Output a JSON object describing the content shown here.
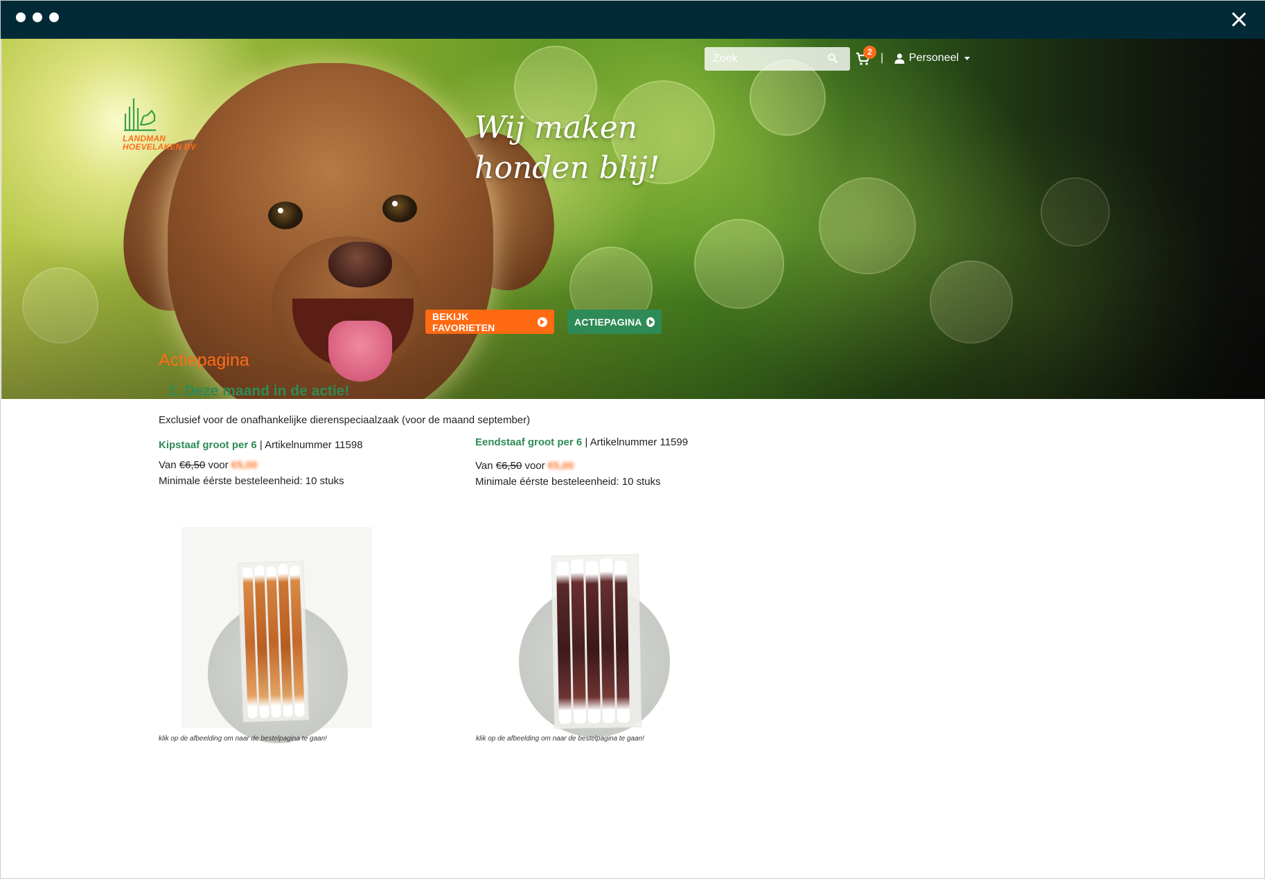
{
  "window": {
    "controls": [
      "dot",
      "dot",
      "dot"
    ],
    "close_icon": "close-icon"
  },
  "brand": {
    "logo_line1": "LANDMAN",
    "logo_line2": "HOEVELAKEN BV",
    "accent_orange": "#ff6c1a",
    "accent_green": "#2e8b57"
  },
  "hero": {
    "slogan_line1": "Wij maken",
    "slogan_line2": "honden blij!",
    "favorites_button": "BEKIJK FAVORIETEN",
    "action_button": "ACTIEPAGINA"
  },
  "header": {
    "search_placeholder": "Zoek",
    "cart_count": "2",
    "separator": "|",
    "account_label": "Personeel"
  },
  "main": {
    "page_title": "Actiepagina",
    "section_title": "1. Deze maand in de actie!",
    "intro": "Exclusief voor de onafhankelijke dierenspeciaalzaak (voor de maand september)",
    "products": [
      {
        "name": "Kipstaaf groot per 6",
        "article": "| Artikelnummer 11598",
        "price_prefix": "Van",
        "old_price": "€6,50",
        "price_mid": "voor",
        "new_price": "€5,00",
        "min_order": "Minimale éérste besteleenheid: 10 stuks",
        "caption": "klik op de afbeelding om naar de bestelpagina te gaan!"
      },
      {
        "name": "Eendstaaf groot per 6",
        "article": "| Artikelnummer 11599",
        "price_prefix": "Van",
        "old_price": "€6,50",
        "price_mid": "voor",
        "new_price": "€5,00",
        "min_order": "Minimale éérste besteleenheid: 10 stuks",
        "caption": "klik op de afbeelding om naar de bestelpagina te gaan!"
      }
    ]
  }
}
